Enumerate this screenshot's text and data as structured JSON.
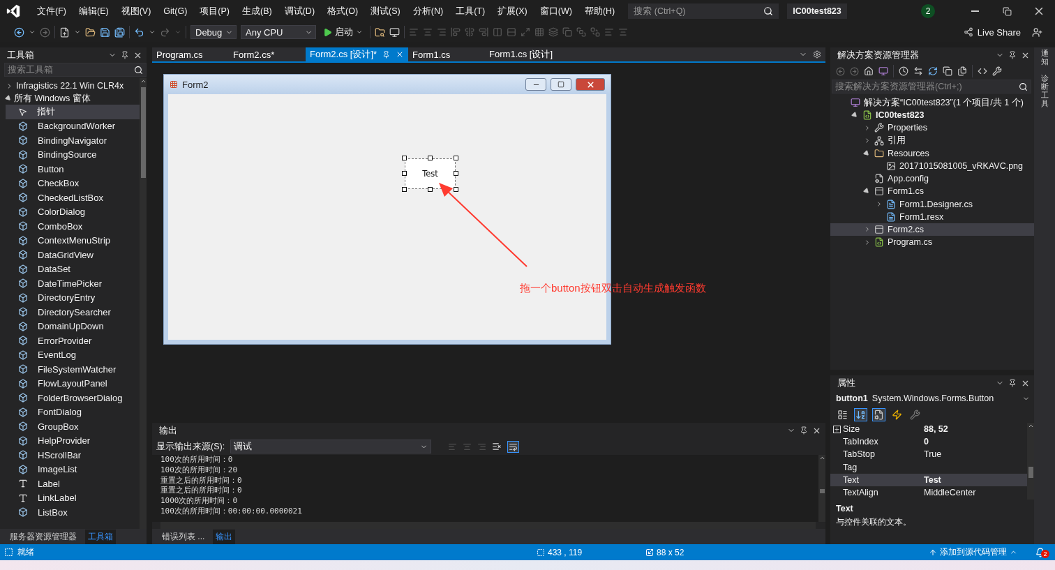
{
  "menu_bar": {
    "items": [
      "文件(F)",
      "编辑(E)",
      "视图(V)",
      "Git(G)",
      "项目(P)",
      "生成(B)",
      "调试(D)",
      "格式(O)",
      "测试(S)",
      "分析(N)",
      "工具(T)",
      "扩展(X)",
      "窗口(W)",
      "帮助(H)"
    ],
    "search": {
      "placeholder": "搜索 (Ctrl+Q)"
    },
    "solution_name": "IC00test823",
    "notification_count": "2"
  },
  "toolbar": {
    "configuration": "Debug",
    "platform": "Any CPU",
    "start": "启动",
    "live_share": "Live Share"
  },
  "toolbox": {
    "title": "工具箱",
    "search": {
      "placeholder": "搜索工具箱"
    },
    "groups": [
      {
        "label": "Infragistics 22.1 Win CLR4x",
        "expanded": false
      },
      {
        "label": "所有 Windows 窗体",
        "expanded": true,
        "children": [
          {
            "label": "指针",
            "kind": "pointer",
            "selected": true
          },
          {
            "label": "BackgroundWorker",
            "kind": "control",
            "selected": false
          },
          {
            "label": "BindingNavigator",
            "kind": "control",
            "selected": false
          },
          {
            "label": "BindingSource",
            "kind": "control",
            "selected": false
          },
          {
            "label": "Button",
            "kind": "control",
            "selected": false
          },
          {
            "label": "CheckBox",
            "kind": "control",
            "selected": false
          },
          {
            "label": "CheckedListBox",
            "kind": "control",
            "selected": false
          },
          {
            "label": "ColorDialog",
            "kind": "control",
            "selected": false
          },
          {
            "label": "ComboBox",
            "kind": "control",
            "selected": false
          },
          {
            "label": "ContextMenuStrip",
            "kind": "control",
            "selected": false
          },
          {
            "label": "DataGridView",
            "kind": "control",
            "selected": false
          },
          {
            "label": "DataSet",
            "kind": "control",
            "selected": false
          },
          {
            "label": "DateTimePicker",
            "kind": "control",
            "selected": false
          },
          {
            "label": "DirectoryEntry",
            "kind": "control",
            "selected": false
          },
          {
            "label": "DirectorySearcher",
            "kind": "control",
            "selected": false
          },
          {
            "label": "DomainUpDown",
            "kind": "control",
            "selected": false
          },
          {
            "label": "ErrorProvider",
            "kind": "control",
            "selected": false
          },
          {
            "label": "EventLog",
            "kind": "control",
            "selected": false
          },
          {
            "label": "FileSystemWatcher",
            "kind": "control",
            "selected": false
          },
          {
            "label": "FlowLayoutPanel",
            "kind": "control",
            "selected": false
          },
          {
            "label": "FolderBrowserDialog",
            "kind": "control",
            "selected": false
          },
          {
            "label": "FontDialog",
            "kind": "control",
            "selected": false
          },
          {
            "label": "GroupBox",
            "kind": "control",
            "selected": false
          },
          {
            "label": "HelpProvider",
            "kind": "control",
            "selected": false
          },
          {
            "label": "HScrollBar",
            "kind": "control",
            "selected": false
          },
          {
            "label": "ImageList",
            "kind": "control",
            "selected": false
          },
          {
            "label": "Label",
            "kind": "label",
            "selected": false
          },
          {
            "label": "LinkLabel",
            "kind": "label",
            "selected": false
          },
          {
            "label": "ListBox",
            "kind": "control",
            "selected": false
          }
        ]
      }
    ],
    "bottom_tabs": [
      {
        "label": "服务器资源管理器",
        "selected": false
      },
      {
        "label": "工具箱",
        "selected": true
      }
    ]
  },
  "editor": {
    "tabs": [
      {
        "label": "Program.cs",
        "selected": false
      },
      {
        "label": "Form2.cs*",
        "selected": false
      },
      {
        "label": "Form2.cs [设计]*",
        "selected": true
      },
      {
        "label": "Form1.cs",
        "selected": false
      },
      {
        "label": "Form1.cs [设计]",
        "selected": false
      }
    ],
    "form": {
      "title": "Form2",
      "button_text": "Test"
    },
    "annotation": "拖一个button按钮双击自动生成触发函数"
  },
  "output": {
    "title": "输出",
    "source_label": "显示输出来源(S):",
    "source": "调试",
    "lines": [
      "100次的所用时间：0",
      "100次的所用时间：20",
      "重置之后的所用时间：0",
      "重置之后的所用时间：0",
      "1000次的所用时间：0",
      "100次的所用时间：00:00:00.0000021"
    ],
    "bottom_tabs": [
      {
        "label": "错误列表 ...",
        "selected": false
      },
      {
        "label": "输出",
        "selected": true
      }
    ]
  },
  "solution_explorer": {
    "title": "解决方案资源管理器",
    "search": {
      "placeholder": "搜索解决方案资源管理器(Ctrl+;)"
    },
    "tree": [
      {
        "label": "解决方案“IC00test823”(1 个项目/共 1 个)",
        "kind": "solution",
        "selected": false,
        "children": [
          {
            "label": "IC00test823",
            "kind": "project",
            "expanded": true,
            "selected": false,
            "children": [
              {
                "label": "Properties",
                "kind": "properties",
                "expanded": false,
                "selected": false
              },
              {
                "label": "引用",
                "kind": "references",
                "expanded": false,
                "selected": false
              },
              {
                "label": "Resources",
                "kind": "folder",
                "expanded": true,
                "selected": false,
                "children": [
                  {
                    "label": "20171015081005_vRKAVC.png",
                    "kind": "image",
                    "selected": false
                  }
                ]
              },
              {
                "label": "App.config",
                "kind": "config",
                "selected": false
              },
              {
                "label": "Form1.cs",
                "kind": "form",
                "expanded": true,
                "selected": false,
                "children": [
                  {
                    "label": "Form1.Designer.cs",
                    "kind": "code",
                    "expanded": false,
                    "selected": false
                  },
                  {
                    "label": "Form1.resx",
                    "kind": "code",
                    "selected": false
                  }
                ]
              },
              {
                "label": "Form2.cs",
                "kind": "form",
                "expanded": false,
                "selected": true
              },
              {
                "label": "Program.cs",
                "kind": "csharp",
                "expanded": false,
                "selected": false
              }
            ]
          }
        ]
      }
    ]
  },
  "properties": {
    "title": "属性",
    "object_name": "button1",
    "object_type": "System.Windows.Forms.Button",
    "toolbar": [
      {
        "kind": "categorized",
        "selected": false
      },
      {
        "kind": "alphabetical",
        "selected": true
      },
      {
        "kind": "properties",
        "selected": true
      },
      {
        "kind": "events",
        "selected": false
      },
      {
        "kind": "pages",
        "selected": false
      }
    ],
    "rows": [
      {
        "name": "Size",
        "value": "88, 52",
        "bold": true,
        "expandable": true,
        "selected": false
      },
      {
        "name": "TabIndex",
        "value": "0",
        "bold": true,
        "expandable": false,
        "selected": false
      },
      {
        "name": "TabStop",
        "value": "True",
        "bold": false,
        "expandable": false,
        "selected": false
      },
      {
        "name": "Tag",
        "expandable": false,
        "selected": false
      },
      {
        "name": "Text",
        "value": "Test",
        "bold": true,
        "expandable": false,
        "selected": true
      },
      {
        "name": "TextAlign",
        "value": "MiddleCenter",
        "bold": false,
        "expandable": false,
        "selected": false
      }
    ],
    "description_title": "Text",
    "description": "与控件关联的文本。"
  },
  "side_tabs": [
    "通知",
    "诊断工具"
  ],
  "status_bar": {
    "message": "就绪",
    "position": "433 , 119",
    "size": "88 x 52",
    "source_control": "添加到源代码管理",
    "notifications": "2"
  }
}
